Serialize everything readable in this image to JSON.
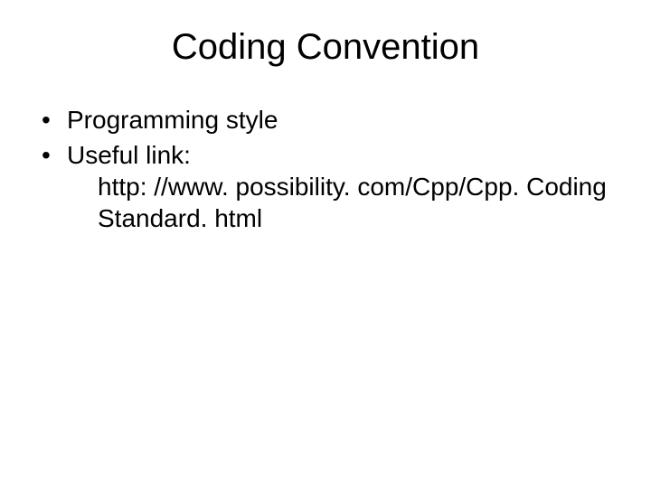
{
  "slide": {
    "title": "Coding Convention",
    "bullets": [
      {
        "text": "Programming style"
      },
      {
        "text": "Useful link:",
        "cont1": "http: //www. possibility. com/Cpp/Cpp. Coding",
        "cont2": "Standard. html"
      }
    ]
  }
}
